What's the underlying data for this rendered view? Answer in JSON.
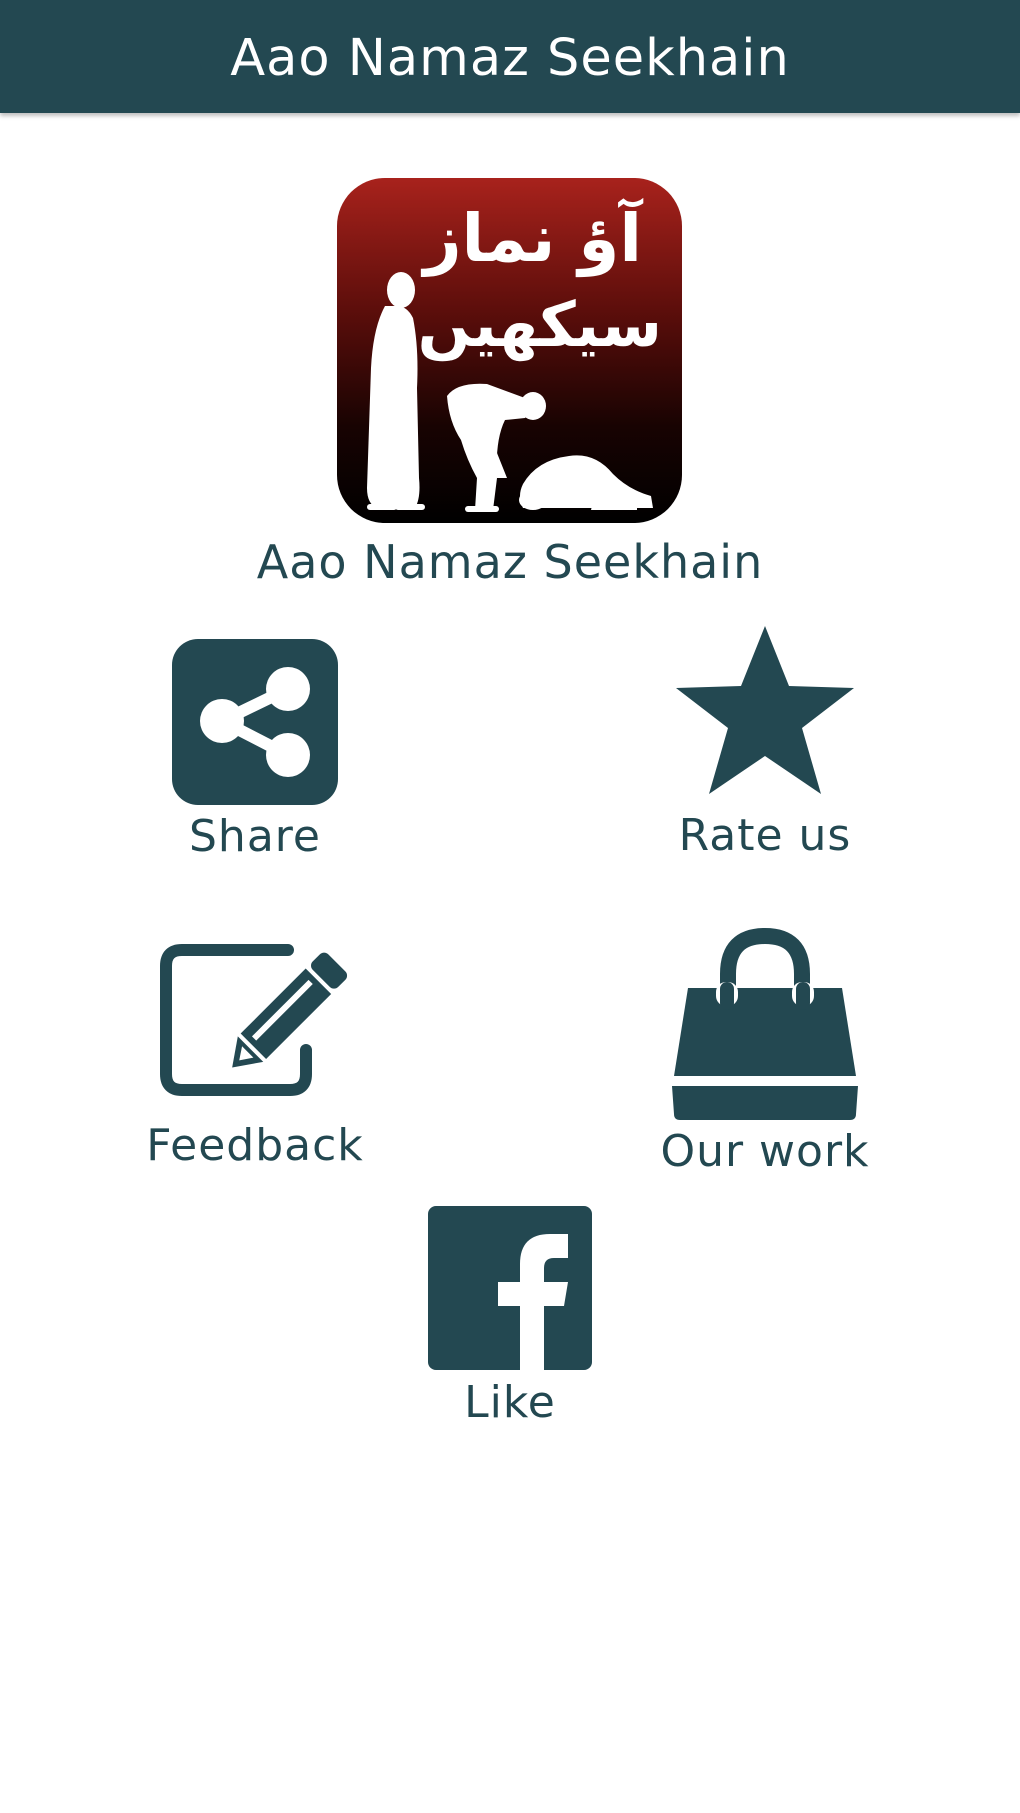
{
  "app_bar": {
    "title": "Aao Namaz Seekhain"
  },
  "logo": {
    "urdu_line_1": "آؤ نماز",
    "urdu_line_2": "سیکھیں"
  },
  "app_name": "Aao Namaz Seekhain",
  "actions": {
    "share": {
      "label": "Share",
      "icon": "share-icon"
    },
    "rate": {
      "label": "Rate us",
      "icon": "star-icon"
    },
    "feedback": {
      "label": "Feedback",
      "icon": "edit-icon"
    },
    "our_work": {
      "label": "Our work",
      "icon": "shopping-bag-icon"
    },
    "like": {
      "label": "Like",
      "icon": "facebook-icon"
    }
  },
  "colors": {
    "primary": "#234851",
    "background": "#ffffff",
    "logo_top": "#a8221c",
    "logo_bottom": "#000000"
  }
}
